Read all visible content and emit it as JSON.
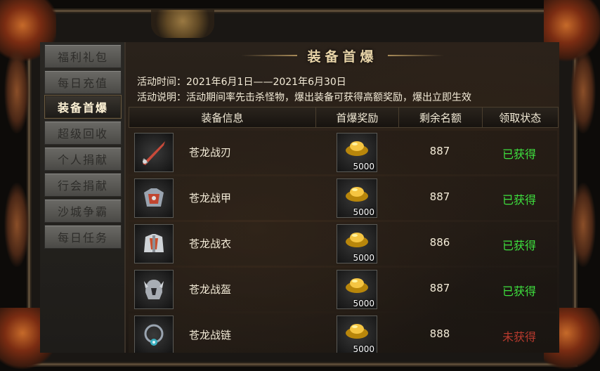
{
  "sidebar": {
    "items": [
      {
        "label": "福利礼包",
        "active": false
      },
      {
        "label": "每日充值",
        "active": false
      },
      {
        "label": "装备首爆",
        "active": true
      },
      {
        "label": "超级回收",
        "active": false
      },
      {
        "label": "个人捐献",
        "active": false
      },
      {
        "label": "行会捐献",
        "active": false
      },
      {
        "label": "沙城争霸",
        "active": false
      },
      {
        "label": "每日任务",
        "active": false
      }
    ]
  },
  "panel": {
    "title": "装备首爆",
    "time_text": "活动时间：2021年6月1日——2021年6月30日",
    "desc_text": "活动说明：活动期间率先击杀怪物，爆出装备可获得高额奖励，爆出立即生效"
  },
  "table": {
    "headers": [
      "装备信息",
      "首爆奖励",
      "剩余名额",
      "领取状态"
    ],
    "rows": [
      {
        "name": "苍龙战刃",
        "reward": "5000",
        "remaining": "887",
        "status": "已获得",
        "obtained": true,
        "icon": "sword-icon"
      },
      {
        "name": "苍龙战甲",
        "reward": "5000",
        "remaining": "887",
        "status": "已获得",
        "obtained": true,
        "icon": "armor-icon"
      },
      {
        "name": "苍龙战衣",
        "reward": "5000",
        "remaining": "886",
        "status": "已获得",
        "obtained": true,
        "icon": "robe-icon"
      },
      {
        "name": "苍龙战盔",
        "reward": "5000",
        "remaining": "887",
        "status": "已获得",
        "obtained": true,
        "icon": "helmet-icon"
      },
      {
        "name": "苍龙战链",
        "reward": "5000",
        "remaining": "888",
        "status": "未获得",
        "obtained": false,
        "icon": "necklace-icon"
      }
    ]
  },
  "colors": {
    "obtained": "#3ee03e",
    "not_obtained": "#b83a2e",
    "accent_gold": "#e8d4a8"
  },
  "icons": {
    "reward": "gold-ingot-icon"
  }
}
